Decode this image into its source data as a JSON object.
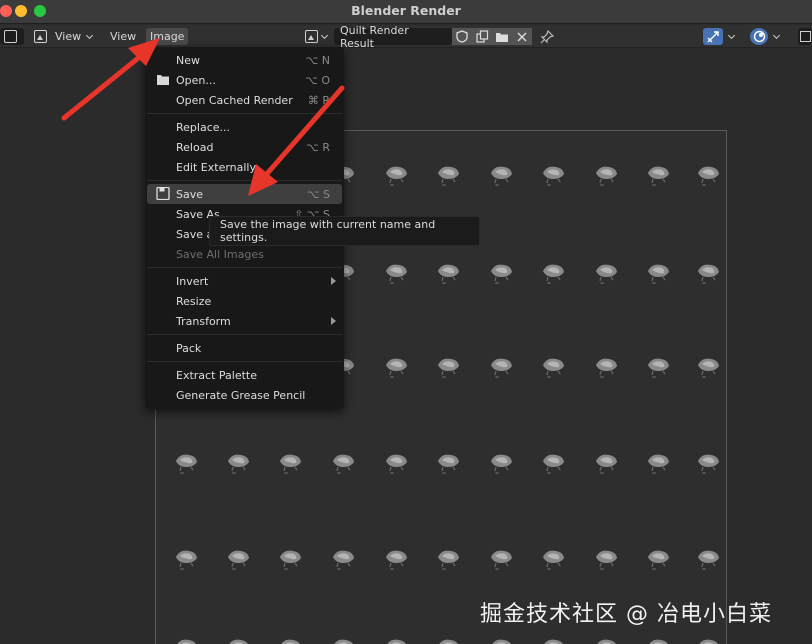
{
  "window": {
    "title": "Blender Render"
  },
  "header": {
    "view_menu": "View",
    "view_label": "View",
    "image_menu": "Image",
    "image_name": "Quilt Render Result"
  },
  "menu": {
    "items": [
      {
        "label": "New",
        "shortcut": "⌥ N"
      },
      {
        "label": "Open...",
        "shortcut": "⌥ O"
      },
      {
        "label": "Open Cached Render",
        "shortcut": "⌘ R"
      },
      {
        "label": "Replace...",
        "shortcut": ""
      },
      {
        "label": "Reload",
        "shortcut": "⌥ R"
      },
      {
        "label": "Edit Externally",
        "shortcut": ""
      },
      {
        "label": "Save",
        "shortcut": "⌥ S"
      },
      {
        "label": "Save As",
        "shortcut": "⇧ ⌥ S"
      },
      {
        "label": "Save a",
        "shortcut": ""
      },
      {
        "label": "Save All Images",
        "shortcut": ""
      },
      {
        "label": "Invert",
        "shortcut": ""
      },
      {
        "label": "Resize",
        "shortcut": ""
      },
      {
        "label": "Transform",
        "shortcut": ""
      },
      {
        "label": "Pack",
        "shortcut": ""
      },
      {
        "label": "Extract Palette",
        "shortcut": ""
      },
      {
        "label": "Generate Grease Pencil",
        "shortcut": ""
      }
    ]
  },
  "tooltip": {
    "text": "Save the image with current name and settings."
  },
  "watermark": {
    "text": "掘金技术社区 @ 冶电小白菜"
  },
  "colors": {
    "annotation_arrow": "#e8352a",
    "highlight": "#3f3f3f",
    "accent": "#4772b3"
  }
}
